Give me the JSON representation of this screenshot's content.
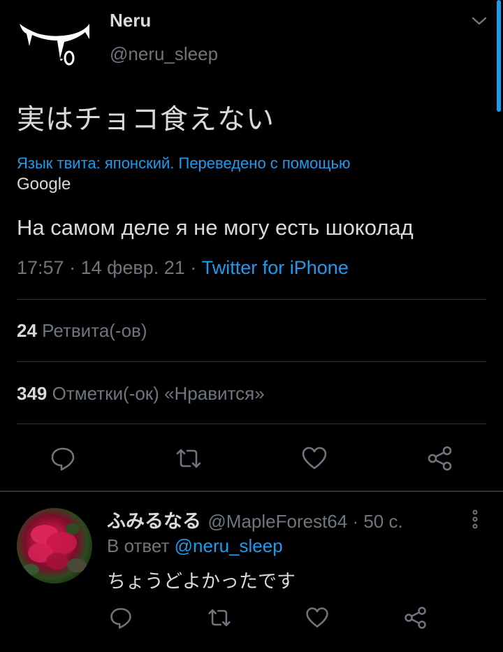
{
  "tweet": {
    "author_name": "Neru",
    "author_handle": "@neru_sleep",
    "text": "実はチョコ食えない",
    "translation_note": "Язык твита: японский. Переведено с помощью",
    "translation_provider": "Google",
    "translated_text": "На самом деле я не могу есть шоколад",
    "time": "17:57",
    "date": "14 февр. 21",
    "source": "Twitter for iPhone",
    "retweets_count": "24",
    "retweets_label": "Ретвита(-ов)",
    "likes_count": "349",
    "likes_label": "Отметки(-ок) «Нравится»"
  },
  "reply": {
    "author_name": "ふみるなる",
    "author_handle": "@MapleForest64",
    "age": "50 с.",
    "reply_prefix": "В ответ",
    "reply_to": "@neru_sleep",
    "text": "ちょうどよかったです"
  },
  "icons": {
    "reply": "reply-icon",
    "retweet": "retweet-icon",
    "like": "heart-icon",
    "share": "share-icon",
    "chevron": "chevron-down-icon",
    "more": "more-vertical-icon"
  },
  "colors": {
    "background": "#000000",
    "text": "#d9d9d9",
    "muted": "#6e767d",
    "accent": "#1d9bf0",
    "divider": "#2f3336"
  }
}
